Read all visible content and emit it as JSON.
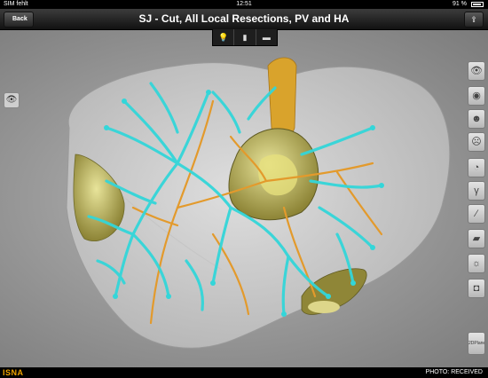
{
  "status_bar": {
    "carrier": "SIM fehlt",
    "time": "12:51",
    "battery": "91 %"
  },
  "nav_bar": {
    "back_label": "Back",
    "title": "SJ - Cut, All Local Resections, PV and HA"
  },
  "view_segments": [
    {
      "icon": "lightbulb-icon",
      "glyph": "💡"
    },
    {
      "icon": "bar-chart-icon",
      "glyph": "▮"
    },
    {
      "icon": "clapperboard-icon",
      "glyph": "▬"
    }
  ],
  "left_tools": {
    "eye_glyph": "👁"
  },
  "right_toolbar": [
    {
      "name": "eye-icon",
      "glyph": "👁"
    },
    {
      "name": "fingerprint-icon",
      "glyph": "◉"
    },
    {
      "name": "head-icon",
      "glyph": "☻"
    },
    {
      "name": "skull-icon",
      "glyph": "☹"
    },
    {
      "name": "protractor-icon",
      "glyph": "◔"
    },
    {
      "name": "curve-icon",
      "glyph": "γ"
    },
    {
      "name": "line-icon",
      "glyph": "∕"
    },
    {
      "name": "ruler-icon",
      "glyph": "▰"
    },
    {
      "name": "brightness-icon",
      "glyph": "☼"
    },
    {
      "name": "camera-icon",
      "glyph": "◘"
    }
  ],
  "plane_button": {
    "label": "2DPlane"
  },
  "footer": {
    "logo": "ISNA",
    "credit": "PHOTO: RECEIVED"
  },
  "colors": {
    "vessels_cyan": "#33d6d9",
    "vessels_orange": "#e39a2c",
    "tumor_olive": "#b3a74a",
    "liver_gray": "#d7d7d7"
  }
}
